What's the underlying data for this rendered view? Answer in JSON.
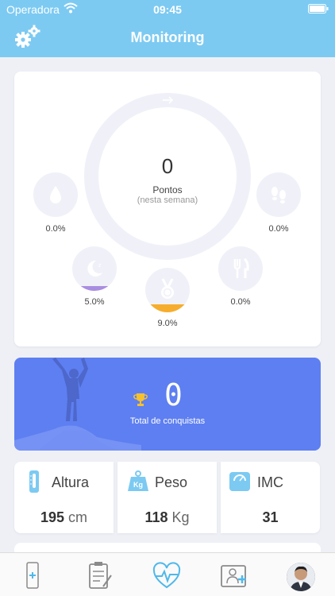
{
  "status_bar": {
    "carrier": "Operadora",
    "time": "09:45"
  },
  "header": {
    "title": "Monitoring"
  },
  "weekly": {
    "points": "0",
    "points_label": "Pontos",
    "points_sub": "(nesta semana)",
    "metrics": [
      {
        "icon": "water-drop-icon",
        "percent": "0.0%",
        "value": 0.0
      },
      {
        "icon": "footsteps-icon",
        "percent": "0.0%",
        "value": 0.0
      },
      {
        "icon": "sleep-moon-icon",
        "percent": "5.0%",
        "value": 5.0
      },
      {
        "icon": "medal-icon",
        "percent": "9.0%",
        "value": 9.0
      },
      {
        "icon": "fork-knife-icon",
        "percent": "0.0%",
        "value": 0.0
      }
    ]
  },
  "conquests": {
    "count": "0",
    "label": "Total de conquistas"
  },
  "measures": [
    {
      "name": "Altura",
      "value": "195",
      "unit": "cm",
      "icon": "thermometer-icon"
    },
    {
      "name": "Peso",
      "value": "118",
      "unit": "Kg",
      "icon": "weight-icon"
    },
    {
      "name": "IMC",
      "value": "31",
      "unit": "",
      "icon": "scale-icon"
    }
  ],
  "tabs": [
    {
      "icon": "phone-health-icon"
    },
    {
      "icon": "clipboard-icon"
    },
    {
      "icon": "heart-pulse-icon",
      "active": true
    },
    {
      "icon": "medical-card-icon"
    },
    {
      "icon": "avatar"
    }
  ],
  "colors": {
    "header": "#7ccaf2",
    "banner": "#5e7ff1",
    "sleep_fill": "#a98ee0",
    "medal_fill": "#f6ad2e",
    "active_tab": "#4fb8ea"
  }
}
